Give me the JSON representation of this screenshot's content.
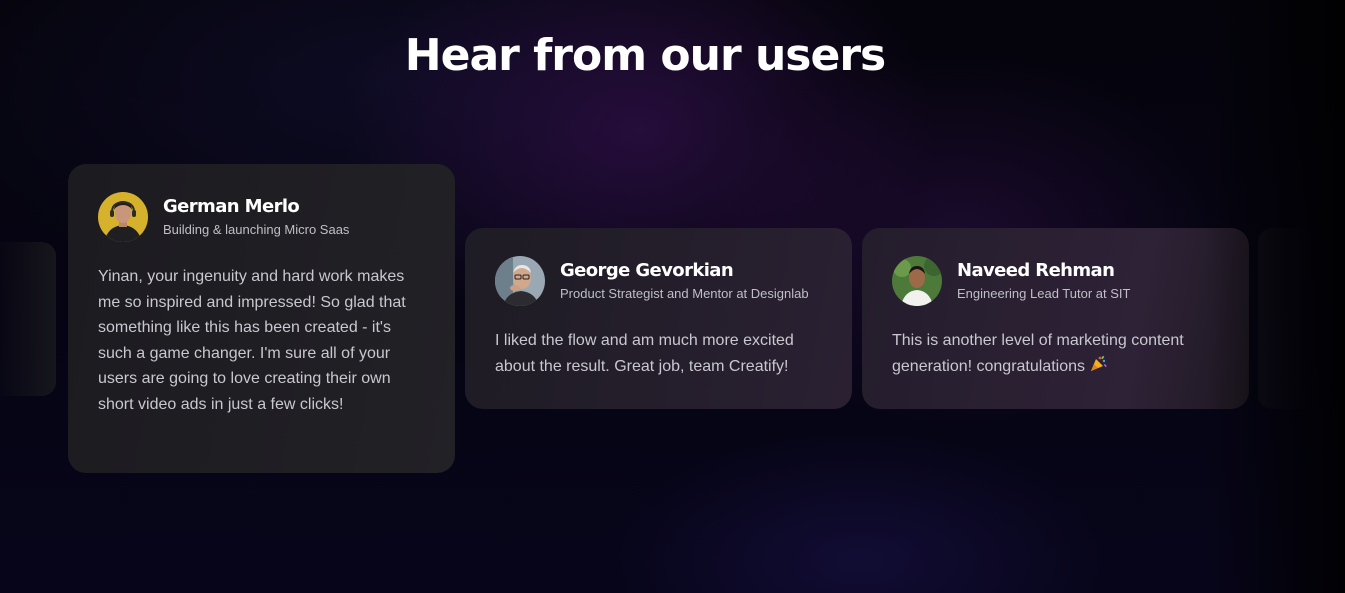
{
  "section": {
    "title": "Hear from our users"
  },
  "testimonials": [
    {
      "name": "German Merlo",
      "role": "Building & launching Micro Saas",
      "quote": "Yinan, your ingenuity and hard work makes me so inspired and impressed! So glad that something like this has been created - it's such a game changer. I'm sure all of your users are going to love creating their own short video ads in just a few clicks!",
      "avatar_bg": "#d9b62e"
    },
    {
      "name": "George Gevorkian",
      "role": "Product Strategist and Mentor at Designlab",
      "quote": "I liked the flow and am much more excited about the result. Great job, team Creatify!",
      "avatar_bg": "#8b9cab"
    },
    {
      "name": "Naveed Rehman",
      "role": "Engineering Lead Tutor at SIT",
      "quote": "This is another level of marketing content generation! congratulations",
      "emoji": "tada-icon",
      "avatar_bg": "#4f7a3a"
    }
  ],
  "colors": {
    "background": "#05040c",
    "accent_glow": "#3e1258",
    "card_bg": "#1e1c24",
    "text_primary": "#ffffff",
    "text_secondary": "#c9c7cf"
  }
}
